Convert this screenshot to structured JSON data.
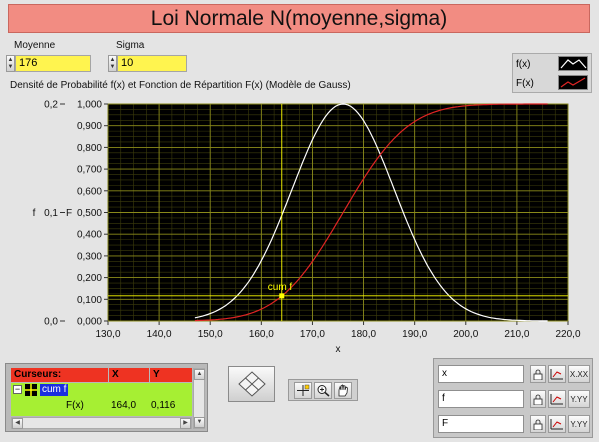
{
  "window": {
    "title": "Loi Normale N(moyenne,sigma)"
  },
  "controls": {
    "moyenne": {
      "label": "Moyenne",
      "value": "176"
    },
    "sigma": {
      "label": "Sigma",
      "value": "10"
    }
  },
  "plot_legend": [
    {
      "name": "f(x)",
      "color": "#ffffff"
    },
    {
      "name": "F(x)",
      "color": "#e02424"
    }
  ],
  "graph_caption": "Densité de Probabilité f(x) et Fonction de Répartition F(x) (Modèle de Gauss)",
  "chart_data": {
    "type": "line",
    "title": "Densité de Probabilité f(x) et Fonction de Répartition F(x) (Modèle de Gauss)",
    "xlabel": "x",
    "ylabel_left": "f",
    "ylabel_right": "F",
    "xlim": [
      130,
      220
    ],
    "ylim_left": [
      0,
      0.2
    ],
    "ylim_right": [
      0,
      1
    ],
    "x_ticks": [
      "130,0",
      "140,0",
      "150,0",
      "160,0",
      "170,0",
      "180,0",
      "190,0",
      "200,0",
      "210,0",
      "220,0"
    ],
    "y_left_ticks": [
      "0,0",
      "0,1",
      "0,2"
    ],
    "y_right_ticks": [
      "0,000",
      "0,100",
      "0,200",
      "0,300",
      "0,400",
      "0,500",
      "0,600",
      "0,700",
      "0,800",
      "0,900",
      "1,000"
    ],
    "grid": true,
    "background": "#000000",
    "grid_color": "#8a8a1a",
    "x_range_of_data": [
      147,
      216
    ],
    "series": [
      {
        "name": "f(x)",
        "color": "#ffffff",
        "model": "gaussian_pdf_scaled_to_1",
        "mean": 176,
        "sigma": 10
      },
      {
        "name": "F(x)",
        "color": "#e02424",
        "model": "gaussian_cdf",
        "mean": 176,
        "sigma": 10
      }
    ],
    "cursor": {
      "name": "cum f",
      "x": 164.0,
      "y": 0.116,
      "color": "#ffff00"
    }
  },
  "cursor_panel": {
    "headers": [
      "Curseurs:",
      "X",
      "Y"
    ],
    "cursor_name": "cum f",
    "row": {
      "label": "F(x)",
      "x": "164,0",
      "y": "0,116"
    }
  },
  "scale_legend": {
    "rows": [
      {
        "name": "x",
        "lock": "lock-icon",
        "fmt": "X.XX"
      },
      {
        "name": "f",
        "lock": "lock-icon",
        "fmt": "Y.YY"
      },
      {
        "name": "F",
        "lock": "lock-icon",
        "fmt": "Y.YY"
      }
    ]
  }
}
